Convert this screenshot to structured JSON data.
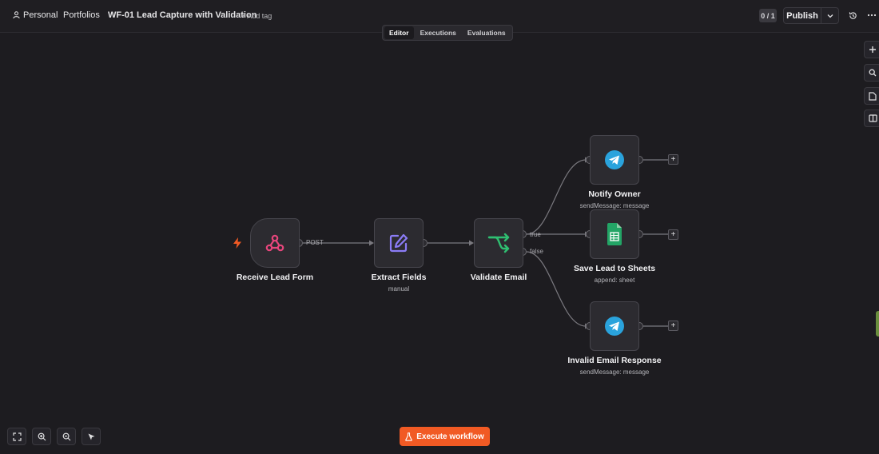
{
  "header": {
    "project": "Personal",
    "folder": "Portfolios",
    "workflow_name": "WF-01 Lead Capture with Validation",
    "add_tag": "+ Add tag",
    "counter": "0 / 1",
    "publish_label": "Publish"
  },
  "tabs": [
    {
      "label": "Editor",
      "active": true
    },
    {
      "label": "Executions",
      "active": false
    },
    {
      "label": "Evaluations",
      "active": false
    }
  ],
  "nodes": {
    "receive": {
      "title": "Receive Lead Form",
      "icon": "webhook-icon"
    },
    "extract": {
      "title": "Extract Fields",
      "subtitle": "manual",
      "icon": "edit-icon"
    },
    "validate": {
      "title": "Validate Email",
      "icon": "if-branch-icon"
    },
    "notify": {
      "title": "Notify Owner",
      "subtitle": "sendMessage: message",
      "icon": "telegram-icon"
    },
    "sheets": {
      "title": "Save Lead to Sheets",
      "subtitle": "append: sheet",
      "icon": "google-sheets-icon"
    },
    "invalid": {
      "title": "Invalid Email Response",
      "subtitle": "sendMessage: message",
      "icon": "telegram-icon"
    }
  },
  "wire_labels": {
    "post": "POST",
    "true": "true",
    "false": "false"
  },
  "add_node_symbol": "+",
  "execute_label": "Execute workflow",
  "colors": {
    "accent": "#f15a24",
    "webhook": "#e8467c",
    "edit": "#8b7cf6",
    "branch": "#2fbf71",
    "telegram": "#2aa3dc",
    "sheets": "#23a566"
  }
}
